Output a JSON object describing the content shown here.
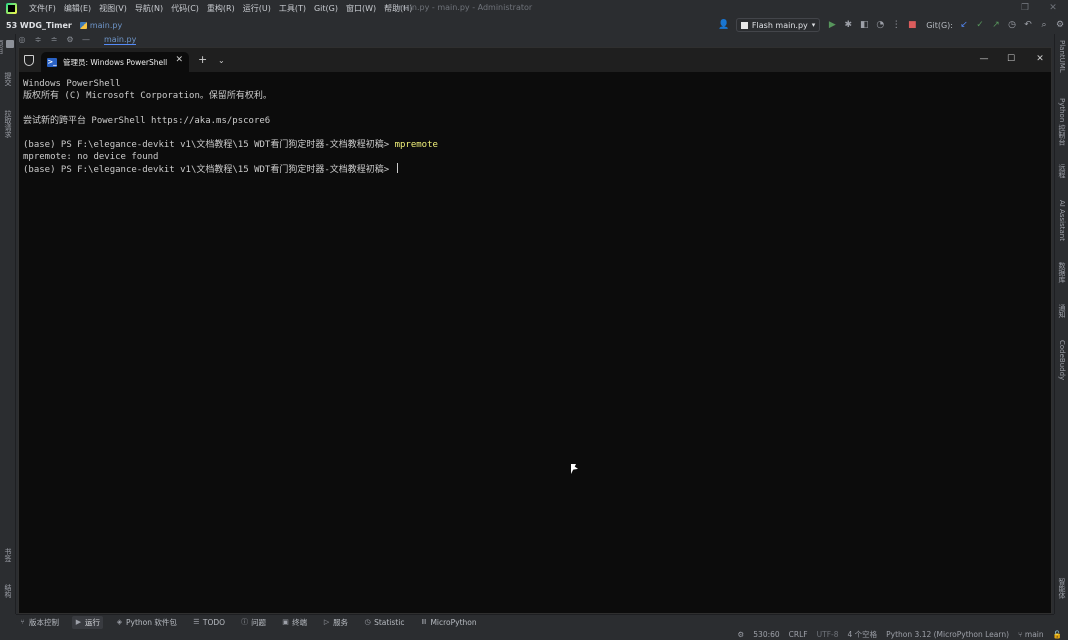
{
  "menubar": {
    "items": [
      "文件(F)",
      "编辑(E)",
      "视图(V)",
      "导航(N)",
      "代码(C)",
      "重构(R)",
      "运行(U)",
      "工具(T)",
      "Git(G)",
      "窗口(W)",
      "帮助(H)"
    ],
    "window_title": "main.py - main.py - Administrator"
  },
  "toolbar": {
    "project": "53 WDG_Timer",
    "file_crumb": "main.py",
    "run_config": "Flash main.py",
    "git_label": "Git(G):"
  },
  "subbar": {
    "tab": "main.py"
  },
  "left_strip": {
    "items": [
      "项目",
      "提交",
      "拉取请求",
      "书签",
      "结构"
    ]
  },
  "right_strip": {
    "items": [
      "PlantUML",
      "Python 控制台",
      "远程",
      "AI Assistant",
      "数据库",
      "通知",
      "CodeBuddy",
      "智能体"
    ]
  },
  "terminal": {
    "tab_label": "管理员: Windows PowerShell",
    "ps_icon": ">_",
    "lines": {
      "l1": "Windows PowerShell",
      "l2": "版权所有 (C) Microsoft Corporation。保留所有权利。",
      "l3": "",
      "l4": "尝试新的跨平台 PowerShell https://aka.ms/pscore6",
      "l5": "",
      "l6_prompt": "(base) PS F:\\elegance-devkit v1\\文档教程\\15 WDT看门狗定时器-文档教程初稿> ",
      "l6_cmd": "mpremote",
      "l7": "mpremote: no device found",
      "l8_prompt": "(base) PS F:\\elegance-devkit v1\\文档教程\\15 WDT看门狗定时器-文档教程初稿> "
    }
  },
  "bottom_tools": {
    "items": [
      "版本控制",
      "运行",
      "Python 软件包",
      "TODO",
      "问题",
      "终端",
      "服务",
      "Statistic",
      "MicroPython"
    ]
  },
  "statusbar": {
    "position": "530:60",
    "line_ending": "CRLF",
    "encoding": "UTF-8",
    "indent": "4 个空格",
    "interpreter": "Python 3.12 (MicroPython Learn)",
    "branch": "main"
  }
}
